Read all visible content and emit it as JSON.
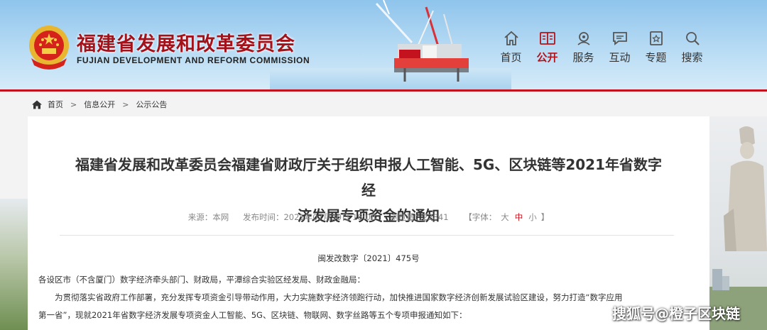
{
  "header": {
    "title": "福建省发展和改革委员会",
    "subtitle": "FUJIAN DEVELOPMENT AND REFORM COMMISSION",
    "nav": [
      {
        "label": "首页",
        "icon": "home-icon"
      },
      {
        "label": "公开",
        "icon": "book-icon",
        "active": true
      },
      {
        "label": "服务",
        "icon": "service-icon"
      },
      {
        "label": "互动",
        "icon": "chat-icon"
      },
      {
        "label": "专题",
        "icon": "topic-icon"
      },
      {
        "label": "搜索",
        "icon": "search-icon"
      }
    ]
  },
  "breadcrumb": {
    "items": [
      "首页",
      "信息公开",
      "公示公告"
    ],
    "separator": ">"
  },
  "article": {
    "title_line1": "福建省发展和改革委员会福建省财政厅关于组织申报人工智能、5G、区块链等2021年省数字经",
    "title_line2": "济发展专项资金的通知",
    "source": "来源：本网",
    "publish_time": "发布时间：2021年07月30日 18:08",
    "views": "浏览量：22841",
    "font_size_label": "【字体：",
    "font_big": "大",
    "font_mid": "中",
    "font_small": "小",
    "font_close": "】",
    "doc_number": "闽发改数字〔2021〕475号",
    "recipients": "各设区市（不含厦门）数字经济牵头部门、财政局，平潭综合实验区经发局、财政金融局：",
    "paragraph1_line1": "为贯彻落实省政府工作部署，充分发挥专项资金引导带动作用，大力实施数字经济领跑行动，加快推进国家数字经济创新发展试验区建设，努力打造“数字应用",
    "paragraph1_line2": "第一省”，现就2021年省数字经济发展专项资金人工智能、5G、区块链、物联网、数字丝路等五个专项申报通知如下："
  },
  "watermark": "搜狐号@橙子区块链",
  "colors": {
    "brand_red": "#c4121e",
    "title_red": "#a3121a",
    "header_sky": "#b7dbf4"
  }
}
